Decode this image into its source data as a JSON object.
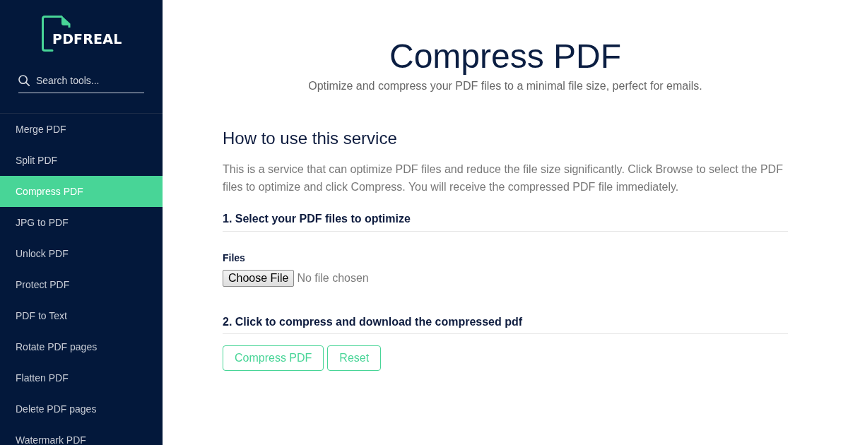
{
  "sidebar": {
    "logo": {
      "text": "PDFREAL"
    },
    "search": {
      "placeholder": "Search tools..."
    },
    "items": [
      {
        "label": "Merge PDF",
        "selected": false
      },
      {
        "label": "Split PDF",
        "selected": false
      },
      {
        "label": "Compress PDF",
        "selected": true
      },
      {
        "label": "JPG to PDF",
        "selected": false
      },
      {
        "label": "Unlock PDF",
        "selected": false
      },
      {
        "label": "Protect PDF",
        "selected": false
      },
      {
        "label": "PDF to Text",
        "selected": false
      },
      {
        "label": "Rotate PDF pages",
        "selected": false
      },
      {
        "label": "Flatten PDF",
        "selected": false
      },
      {
        "label": "Delete PDF pages",
        "selected": false
      },
      {
        "label": "Watermark PDF",
        "selected": false
      }
    ]
  },
  "main": {
    "title": "Compress PDF",
    "subtitle": "Optimize and compress your PDF files to a minimal file size, perfect for emails.",
    "how_to": {
      "heading": "How to use this service",
      "text": "This is a service that can optimize PDF files and reduce the file size significantly. Click Browse to select the PDF files to optimize and click Compress. You will receive the compressed PDF file immediately."
    },
    "steps": [
      {
        "kind": "file",
        "heading": "1. Select your PDF files to optimize",
        "field_label": "Files",
        "button": "Choose File",
        "status": "No file chosen"
      },
      {
        "kind": "buttons",
        "heading": "2. Click to compress and download the compressed pdf",
        "buttons": [
          "Compress PDF",
          "Reset"
        ]
      }
    ]
  }
}
